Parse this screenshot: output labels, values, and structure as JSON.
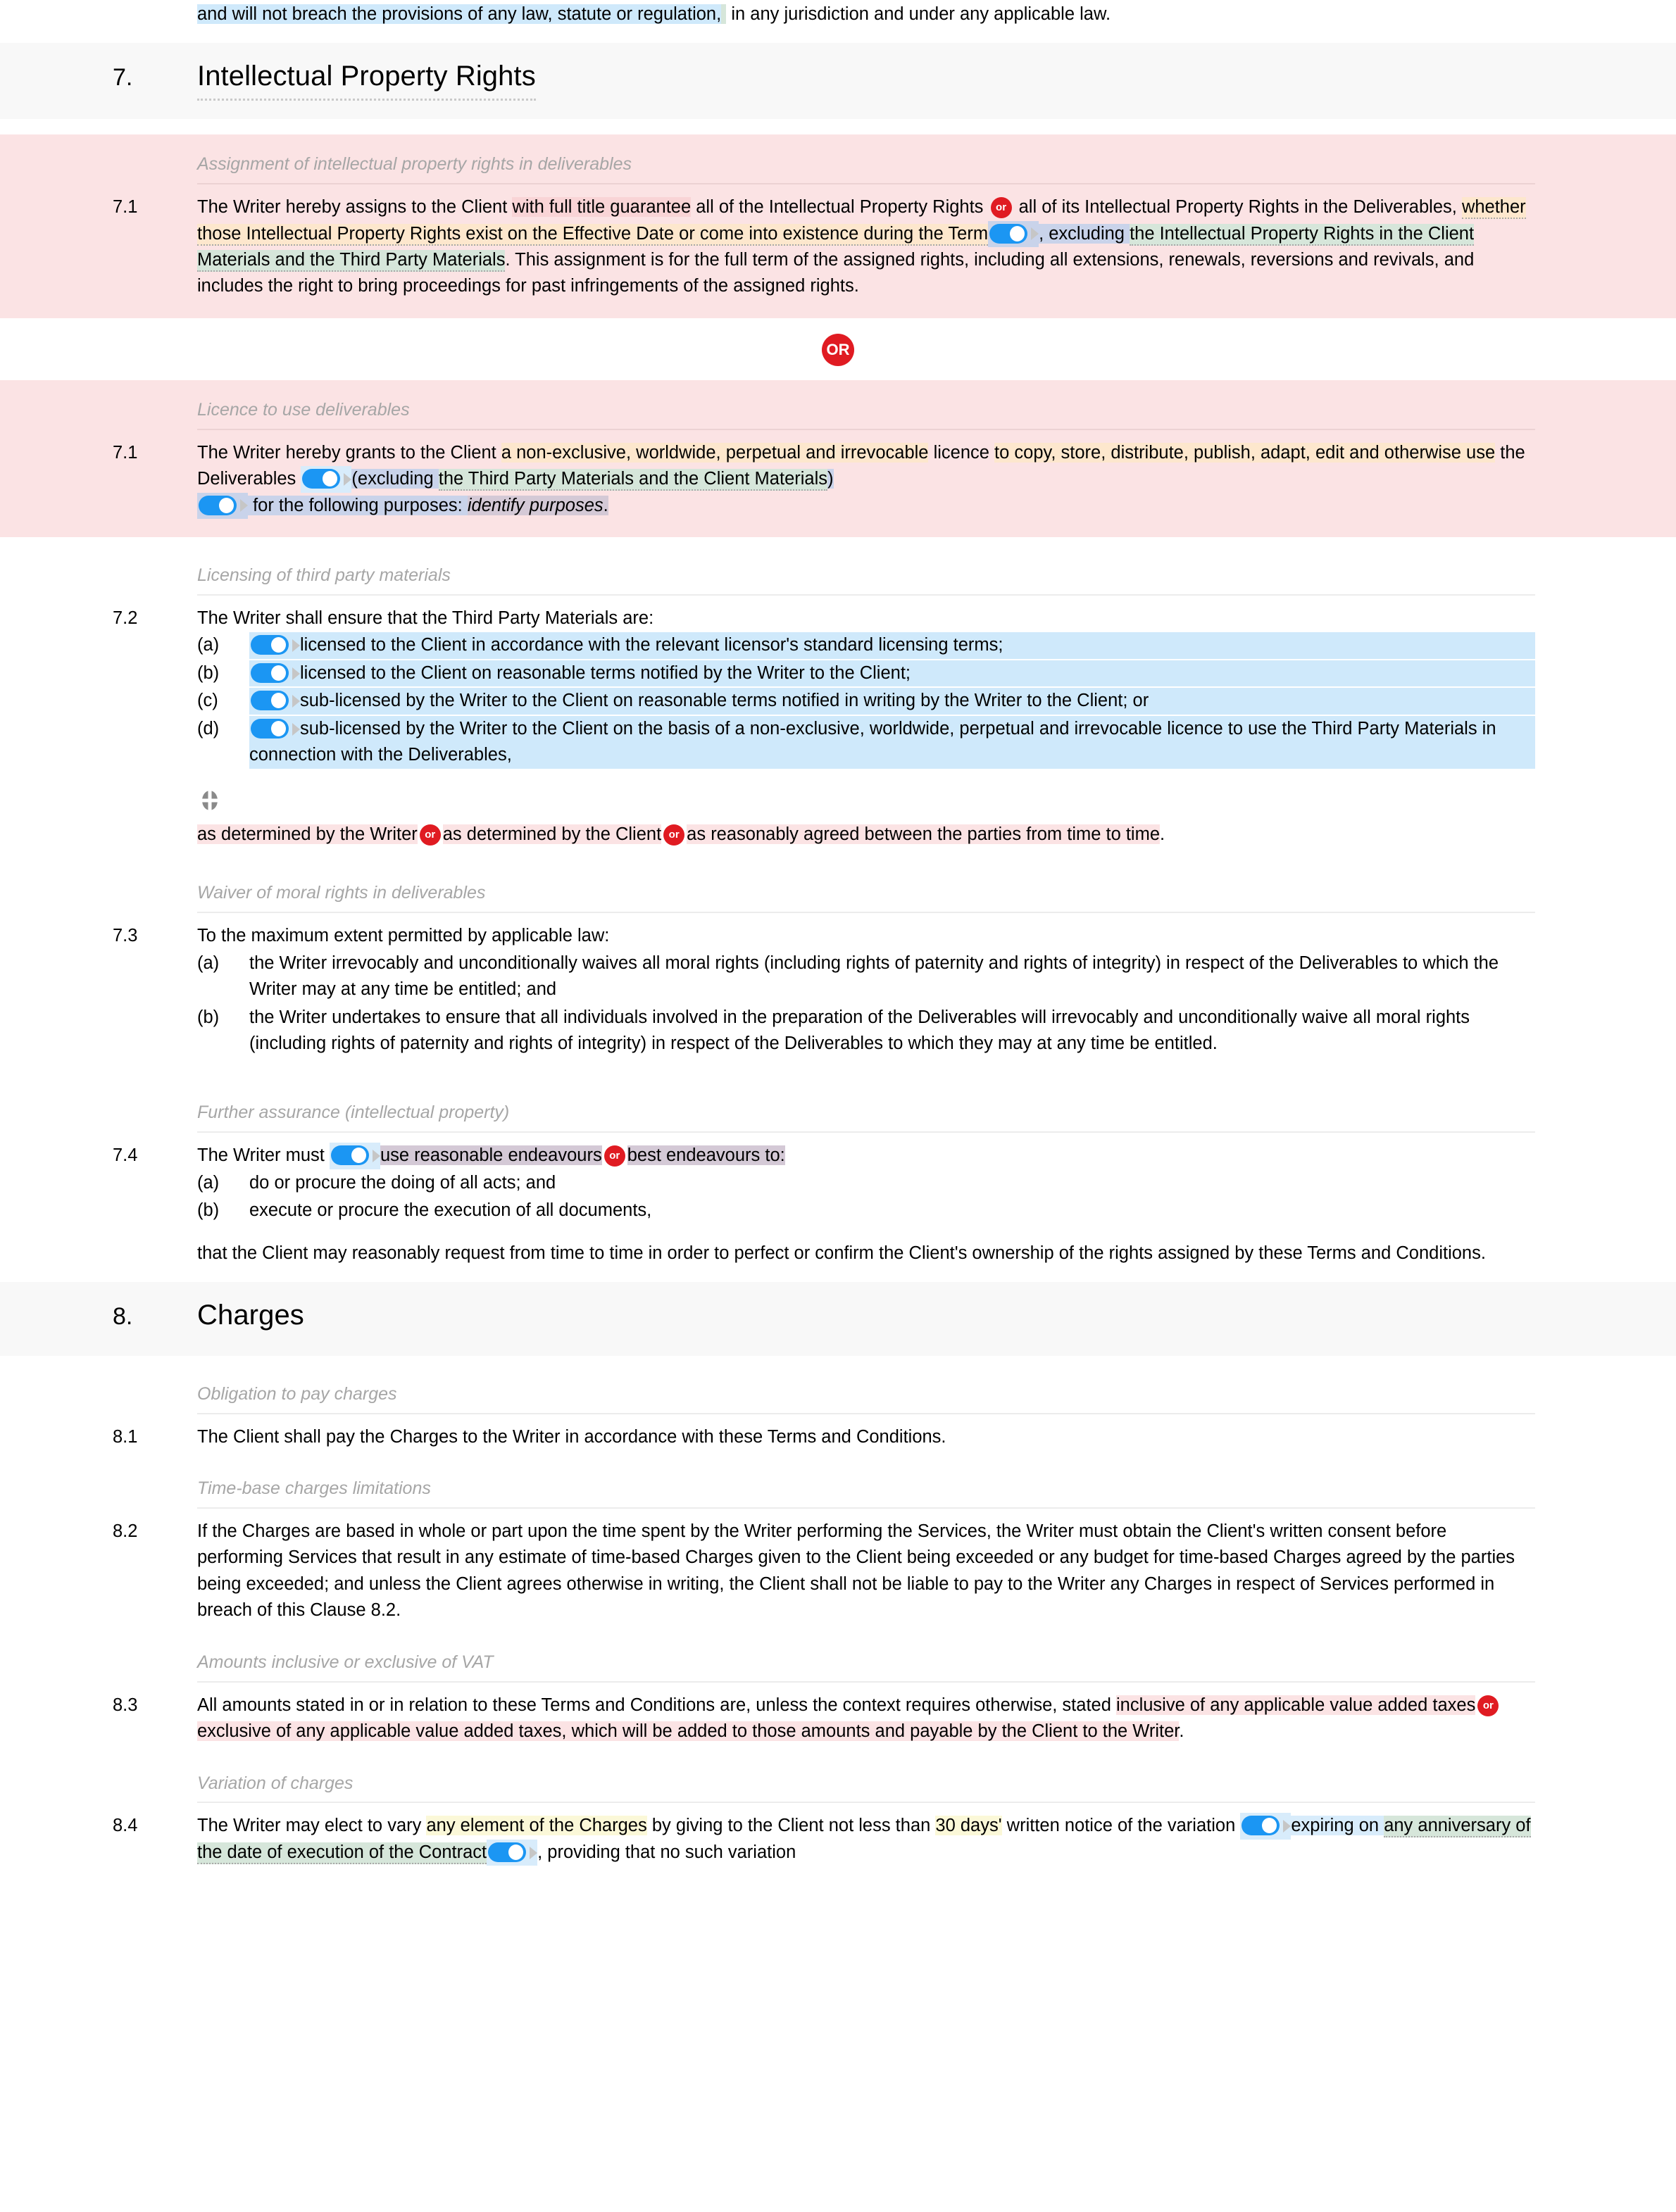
{
  "document": {
    "top_fragment": {
      "seg_blue": "and will not breach the provisions of any law, statute or regulation,",
      "seg_green_part": "the provisions of any law, statute or regulation,",
      "tail": " in any jurisdiction and under any applicable law."
    },
    "sections": [
      {
        "number": "7.",
        "title": "Intellectual Property Rights"
      },
      {
        "number": "8.",
        "title": "Charges"
      }
    ],
    "subheads": {
      "assignment": "Assignment of intellectual property rights in deliverables",
      "licence": "Licence to use deliverables",
      "third_party": "Licensing of third party materials",
      "waiver": "Waiver of moral rights in deliverables",
      "further_assurance": "Further assurance (intellectual property)",
      "obligation": "Obligation to pay charges",
      "time_base": "Time-base charges limitations",
      "vat": "Amounts inclusive or exclusive of VAT",
      "variation": "Variation of charges"
    },
    "clauses": {
      "c71a": {
        "num": "7.1",
        "t1": "The Writer hereby assigns to the Client ",
        "t2": "with full title guarantee",
        "t3": " all of the Intellectual Property Rights ",
        "t4": " all of its Intellectual Property Rights",
        "t5": " in the Deliverables, ",
        "t6": "whether those Intellectual Property Rights exist on the Effective Date or come into existence during the Term",
        "t7": ", excluding ",
        "t8": "the Intellectual Property Rights in the Client Materials and the Third Party Materials",
        "t9": ". This assignment is for the full term of the assigned rights, including all extensions, renewals, reversions and revivals, and includes the right to bring proceedings for past infringements of the assigned rights."
      },
      "or_divider_label": "OR",
      "or_inline_label": "or",
      "c71b": {
        "num": "7.1",
        "t1": "The Writer hereby grants to the Client ",
        "t2": "a non-exclusive, worldwide, perpetual and irrevocable",
        "t3": " licence ",
        "t4": "to copy, store, distribute, publish, adapt, edit and otherwise use",
        "t5": " the Deliverables ",
        "t6": "(excluding ",
        "t7": "the Third Party Materials and the Client Materials",
        "t8": ")",
        "t9": " for the following purposes: ",
        "t10": "identify purposes",
        "t11": "."
      },
      "c72": {
        "num": "7.2",
        "lead": "The Writer shall ensure that the Third Party Materials are:",
        "items": [
          {
            "label": "(a)",
            "text": "licensed to the Client in accordance with the relevant licensor's standard licensing terms;"
          },
          {
            "label": "(b)",
            "text": "licensed to the Client on reasonable terms notified by the Writer to the Client;"
          },
          {
            "label": "(c)",
            "text": "sub-licensed by the Writer to the Client on reasonable terms notified in writing by the Writer to the Client; or"
          },
          {
            "label": "(d)",
            "text": "sub-licensed by the Writer to the Client on the basis of a non-exclusive, worldwide, perpetual and irrevocable licence to use the Third Party Materials in connection with the Deliverables,"
          }
        ],
        "tail_a": "as determined by the Writer",
        "tail_b": "as determined by the Client",
        "tail_c": "as reasonably agreed between the parties from time to time",
        "tail_end": "."
      },
      "c73": {
        "num": "7.3",
        "lead": "To the maximum extent permitted by applicable law:",
        "items": [
          {
            "label": "(a)",
            "text": "the Writer irrevocably and unconditionally waives all moral rights (including rights of paternity and rights of integrity) in respect of the Deliverables to which the Writer may at any time be entitled; and"
          },
          {
            "label": "(b)",
            "text": "the Writer undertakes to ensure that all individuals involved in the preparation of the Deliverables will irrevocably and unconditionally waive all moral rights (including rights of paternity and rights of integrity) in respect of the Deliverables to which they may at any time be entitled."
          }
        ]
      },
      "c74": {
        "num": "7.4",
        "t1": "The Writer must ",
        "t2": "use reasonable endeavours",
        "t3": "best endeavours",
        "t4": " to:",
        "items": [
          {
            "label": "(a)",
            "text": "do or procure the doing of all acts; and"
          },
          {
            "label": "(b)",
            "text": "execute or procure the execution of all documents,"
          }
        ],
        "tail": "that the Client may reasonably request from time to time in order to perfect or confirm the Client's ownership of the rights assigned by these Terms and Conditions."
      },
      "c81": {
        "num": "8.1",
        "text": "The Client shall pay the Charges to the Writer in accordance with these Terms and Conditions."
      },
      "c82": {
        "num": "8.2",
        "text": "If the Charges are based in whole or part upon the time spent by the Writer performing the Services, the Writer must obtain the Client's written consent before performing Services that result in any estimate of time-based Charges given to the Client being exceeded or any budget for time-based Charges agreed by the parties being exceeded; and unless the Client agrees otherwise in writing, the Client shall not be liable to pay to the Writer any Charges in respect of Services performed in breach of this Clause 8.2."
      },
      "c83": {
        "num": "8.3",
        "t1": "All amounts stated in or in relation to these Terms and Conditions are, unless the context requires otherwise, stated ",
        "t2": "inclusive of any applicable value added taxes",
        "t3": "exclusive of any applicable value added taxes, which will be added to those amounts and payable by the Client to the Writer",
        "t4": "."
      },
      "c84": {
        "num": "8.4",
        "t1": "The Writer may elect to vary ",
        "t2": "any element of the Charges",
        "t3": " by giving to the Client not less than ",
        "t4": "30 days'",
        "t5": " written notice of the variation ",
        "t6": "expiring on ",
        "t7": "any anniversary of the date of execution of the Contract",
        "t8": ", providing that no such variation"
      }
    },
    "icons": {
      "toggle": "toggle-switch-on",
      "crosshair": "move-crosshair-icon"
    },
    "colors": {
      "or_badge_red": "#e01b22",
      "toggle_blue": "#1b96f3",
      "section_bar": "#f8f8f8",
      "alt_block_pink": "#fbe3e4"
    }
  }
}
